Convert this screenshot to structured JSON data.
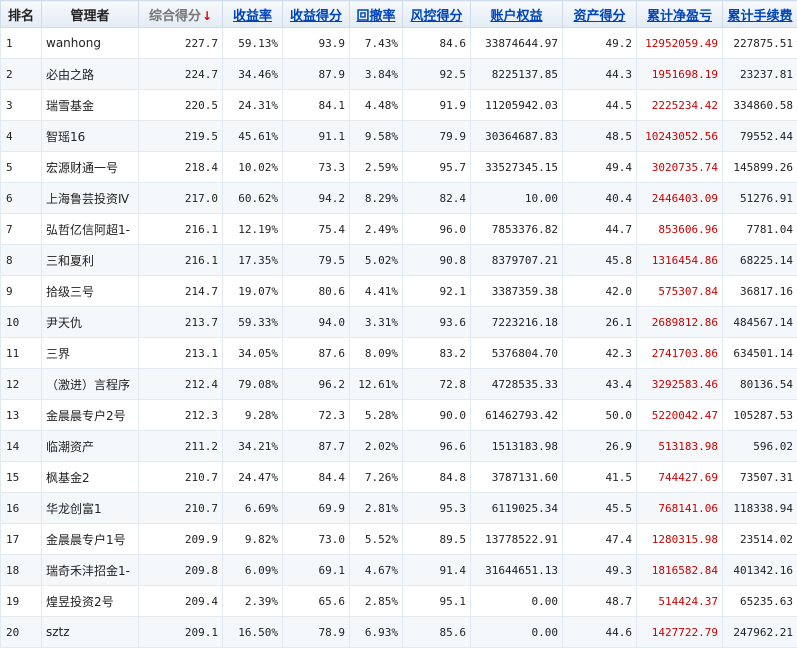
{
  "headers": {
    "rank": "排名",
    "manager": "管理者",
    "score": "综合得分",
    "sort_arrow": "↓",
    "return_rate": "收益率",
    "return_score": "收益得分",
    "drawdown": "回撤率",
    "risk_score": "风控得分",
    "equity": "账户权益",
    "asset_score": "资产得分",
    "cum_pnl": "累计净盈亏",
    "cum_fee": "累计手续费"
  },
  "rows": [
    {
      "rank": "1",
      "manager": "wanhong",
      "score": "227.7",
      "return_rate": "59.13%",
      "return_score": "93.9",
      "drawdown": "7.43%",
      "risk_score": "84.6",
      "equity": "33874644.97",
      "asset_score": "49.2",
      "cum_pnl": "12952059.49",
      "cum_fee": "227875.51"
    },
    {
      "rank": "2",
      "manager": "必由之路",
      "score": "224.7",
      "return_rate": "34.46%",
      "return_score": "87.9",
      "drawdown": "3.84%",
      "risk_score": "92.5",
      "equity": "8225137.85",
      "asset_score": "44.3",
      "cum_pnl": "1951698.19",
      "cum_fee": "23237.81"
    },
    {
      "rank": "3",
      "manager": "瑞雪基金",
      "score": "220.5",
      "return_rate": "24.31%",
      "return_score": "84.1",
      "drawdown": "4.48%",
      "risk_score": "91.9",
      "equity": "11205942.03",
      "asset_score": "44.5",
      "cum_pnl": "2225234.42",
      "cum_fee": "334860.58"
    },
    {
      "rank": "4",
      "manager": "智瑶16",
      "score": "219.5",
      "return_rate": "45.61%",
      "return_score": "91.1",
      "drawdown": "9.58%",
      "risk_score": "79.9",
      "equity": "30364687.83",
      "asset_score": "48.5",
      "cum_pnl": "10243052.56",
      "cum_fee": "79552.44"
    },
    {
      "rank": "5",
      "manager": "宏源财通一号",
      "score": "218.4",
      "return_rate": "10.02%",
      "return_score": "73.3",
      "drawdown": "2.59%",
      "risk_score": "95.7",
      "equity": "33527345.15",
      "asset_score": "49.4",
      "cum_pnl": "3020735.74",
      "cum_fee": "145899.26"
    },
    {
      "rank": "6",
      "manager": "上海鲁芸投资Ⅳ",
      "score": "217.0",
      "return_rate": "60.62%",
      "return_score": "94.2",
      "drawdown": "8.29%",
      "risk_score": "82.4",
      "equity": "10.00",
      "asset_score": "40.4",
      "cum_pnl": "2446403.09",
      "cum_fee": "51276.91"
    },
    {
      "rank": "7",
      "manager": "弘哲亿信阿超1-",
      "score": "216.1",
      "return_rate": "12.19%",
      "return_score": "75.4",
      "drawdown": "2.49%",
      "risk_score": "96.0",
      "equity": "7853376.82",
      "asset_score": "44.7",
      "cum_pnl": "853606.96",
      "cum_fee": "7781.04"
    },
    {
      "rank": "8",
      "manager": "三和夏利",
      "score": "216.1",
      "return_rate": "17.35%",
      "return_score": "79.5",
      "drawdown": "5.02%",
      "risk_score": "90.8",
      "equity": "8379707.21",
      "asset_score": "45.8",
      "cum_pnl": "1316454.86",
      "cum_fee": "68225.14"
    },
    {
      "rank": "9",
      "manager": "拾级三号",
      "score": "214.7",
      "return_rate": "19.07%",
      "return_score": "80.6",
      "drawdown": "4.41%",
      "risk_score": "92.1",
      "equity": "3387359.38",
      "asset_score": "42.0",
      "cum_pnl": "575307.84",
      "cum_fee": "36817.16"
    },
    {
      "rank": "10",
      "manager": "尹天仇",
      "score": "213.7",
      "return_rate": "59.33%",
      "return_score": "94.0",
      "drawdown": "3.31%",
      "risk_score": "93.6",
      "equity": "7223216.18",
      "asset_score": "26.1",
      "cum_pnl": "2689812.86",
      "cum_fee": "484567.14"
    },
    {
      "rank": "11",
      "manager": "三界",
      "score": "213.1",
      "return_rate": "34.05%",
      "return_score": "87.6",
      "drawdown": "8.09%",
      "risk_score": "83.2",
      "equity": "5376804.70",
      "asset_score": "42.3",
      "cum_pnl": "2741703.86",
      "cum_fee": "634501.14"
    },
    {
      "rank": "12",
      "manager": "（激进）言程序",
      "score": "212.4",
      "return_rate": "79.08%",
      "return_score": "96.2",
      "drawdown": "12.61%",
      "risk_score": "72.8",
      "equity": "4728535.33",
      "asset_score": "43.4",
      "cum_pnl": "3292583.46",
      "cum_fee": "80136.54"
    },
    {
      "rank": "13",
      "manager": "金晨晨专户2号",
      "score": "212.3",
      "return_rate": "9.28%",
      "return_score": "72.3",
      "drawdown": "5.28%",
      "risk_score": "90.0",
      "equity": "61462793.42",
      "asset_score": "50.0",
      "cum_pnl": "5220042.47",
      "cum_fee": "105287.53"
    },
    {
      "rank": "14",
      "manager": "临潮资产",
      "score": "211.2",
      "return_rate": "34.21%",
      "return_score": "87.7",
      "drawdown": "2.02%",
      "risk_score": "96.6",
      "equity": "1513183.98",
      "asset_score": "26.9",
      "cum_pnl": "513183.98",
      "cum_fee": "596.02"
    },
    {
      "rank": "15",
      "manager": "枫基金2",
      "score": "210.7",
      "return_rate": "24.47%",
      "return_score": "84.4",
      "drawdown": "7.26%",
      "risk_score": "84.8",
      "equity": "3787131.60",
      "asset_score": "41.5",
      "cum_pnl": "744427.69",
      "cum_fee": "73507.31"
    },
    {
      "rank": "16",
      "manager": "华龙创富1",
      "score": "210.7",
      "return_rate": "6.69%",
      "return_score": "69.9",
      "drawdown": "2.81%",
      "risk_score": "95.3",
      "equity": "6119025.34",
      "asset_score": "45.5",
      "cum_pnl": "768141.06",
      "cum_fee": "118338.94"
    },
    {
      "rank": "17",
      "manager": "金晨晨专户1号",
      "score": "209.9",
      "return_rate": "9.82%",
      "return_score": "73.0",
      "drawdown": "5.52%",
      "risk_score": "89.5",
      "equity": "13778522.91",
      "asset_score": "47.4",
      "cum_pnl": "1280315.98",
      "cum_fee": "23514.02"
    },
    {
      "rank": "18",
      "manager": "瑞奇禾沣招金1-",
      "score": "209.8",
      "return_rate": "6.09%",
      "return_score": "69.1",
      "drawdown": "4.67%",
      "risk_score": "91.4",
      "equity": "31644651.13",
      "asset_score": "49.3",
      "cum_pnl": "1816582.84",
      "cum_fee": "401342.16"
    },
    {
      "rank": "19",
      "manager": "煌昱投资2号",
      "score": "209.4",
      "return_rate": "2.39%",
      "return_score": "65.6",
      "drawdown": "2.85%",
      "risk_score": "95.1",
      "equity": "0.00",
      "asset_score": "48.7",
      "cum_pnl": "514424.37",
      "cum_fee": "65235.63"
    },
    {
      "rank": "20",
      "manager": "sztz",
      "score": "209.1",
      "return_rate": "16.50%",
      "return_score": "78.9",
      "drawdown": "6.93%",
      "risk_score": "85.6",
      "equity": "0.00",
      "asset_score": "44.6",
      "cum_pnl": "1427722.79",
      "cum_fee": "247962.21"
    }
  ]
}
